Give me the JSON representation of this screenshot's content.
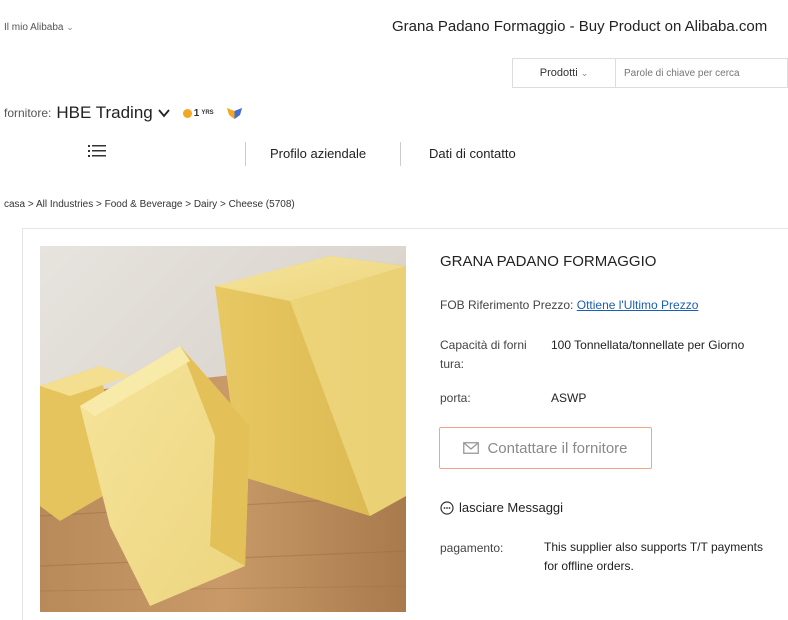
{
  "header": {
    "my_alibaba": "Il mio Alibaba",
    "page_title": "Grana Padano Formaggio - Buy Product on Alibaba.com"
  },
  "search": {
    "category": "Prodotti",
    "placeholder": "Parole di chiave per cerca"
  },
  "supplier": {
    "prefix": "fornitore:",
    "name": "HBE Trading",
    "years": "1",
    "years_suffix": "YRS"
  },
  "nav": {
    "profile": "Profilo aziendale",
    "contacts": "Dati di contatto"
  },
  "breadcrumb": "casa > All Industries > Food & Beverage > Dairy > Cheese (5708)",
  "product": {
    "title": "GRANA PADANO FORMAGGIO",
    "price_label_bold": "FOB Riferimento",
    "price_label_rest": "Prezzo:",
    "price_link": "Ottiene l'Ultimo Prezzo",
    "capacity_label_line1": "Capacità di forni",
    "capacity_label_line2": "tura:",
    "capacity_value": "100 Tonnellata/tonnellate per Giorno",
    "port_label": "porta:",
    "port_value": "ASWP",
    "contact_button": "Contattare il fornitore",
    "leave_message": "lasciare Messaggi",
    "payment_label": "pagamento:",
    "payment_text": "This supplier also supports T/T payments for offline orders."
  },
  "colors": {
    "link": "#1a5fb4",
    "button_border": "#f0a58a",
    "badge_gold": "#f5a623"
  }
}
